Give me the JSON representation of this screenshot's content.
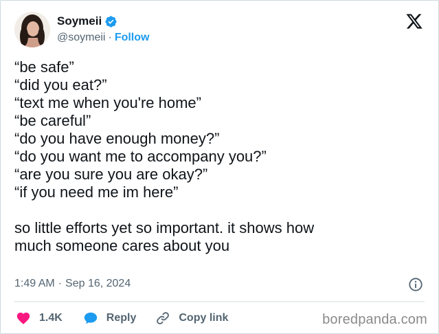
{
  "author": {
    "display_name": "Soymeii",
    "handle": "@soymeii",
    "separator": "·",
    "follow_label": "Follow",
    "verified_color": "#1d9bf0"
  },
  "tweet": {
    "lines": [
      "“be safe”",
      "“did you eat?”",
      "“text me when you're home”",
      "“be careful”",
      "“do you have enough money?”",
      "“do you want me to accompany you?”",
      "“are you sure you are okay?”",
      "“if you need me im here”"
    ],
    "closing": [
      "so little efforts yet so important. it shows how",
      "much someone cares about you"
    ]
  },
  "meta": {
    "time": "1:49 AM",
    "separator": "·",
    "date": "Sep 16, 2024"
  },
  "actions": {
    "like_count": "1.4K",
    "reply_label": "Reply",
    "copy_link_label": "Copy link"
  },
  "icons": {
    "logo": "x-logo-icon",
    "verified": "verified-badge-icon",
    "info": "info-icon",
    "like": "heart-icon",
    "reply": "speech-bubble-icon",
    "copy": "link-icon"
  },
  "colors": {
    "like": "#f91880",
    "reply": "#1d9bf0",
    "follow": "#1d9bf0",
    "muted": "#536471"
  },
  "watermark": "boredpanda.com"
}
